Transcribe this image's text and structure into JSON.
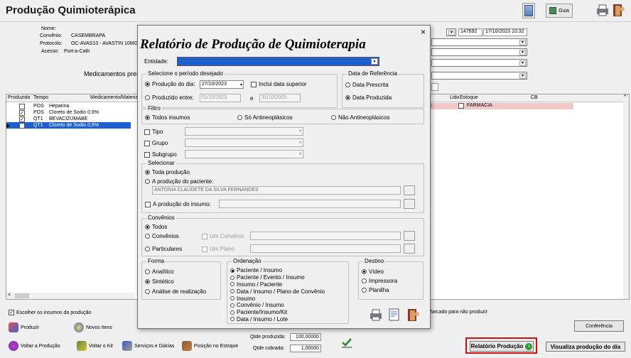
{
  "window": {
    "title": "Produção Quimioterápica"
  },
  "topbar": {
    "guia_label": "Guia"
  },
  "patient": {
    "name_label": "Nome:",
    "convenio_label": "Convênio:",
    "convenio_value": "CASEMBRAPA",
    "protocolo_label": "Protocolo:",
    "protocolo_value": "OC-AVAS10 - AVASTIN 10MG/",
    "acesso_label": "Acesso:",
    "acesso_value": "Port-a-Cath",
    "meds_label": "Medicamentos presc",
    "record_number": "147692",
    "record_datetime": "17/10/2023 10:32"
  },
  "grid": {
    "headers": {
      "produzido": "Produzido",
      "tempo": "Tempo",
      "medicamento": "Medicamento/Materia",
      "lido": "Lido",
      "estoque": "Estoque",
      "cb": "CB"
    },
    "rows": [
      {
        "checked": false,
        "tempo": "POS",
        "med": "Heparina"
      },
      {
        "checked": true,
        "tempo": "POS",
        "med": "Cloreto de Sodio 0,9%"
      },
      {
        "checked": true,
        "tempo": "QT1",
        "med": "BEVACIZUMABE"
      },
      {
        "checked": false,
        "tempo": "QT1",
        "med": "Cloreto de Sodio 0,9%",
        "selected": true
      }
    ],
    "pink_row": {
      "suffix": "rc",
      "estoque": "FARMACIA"
    }
  },
  "footer": {
    "escolher_label": "Escolher os insumos da produção",
    "marcado_label": "Marcado para não produzir",
    "conferencia_label": "Conferência",
    "produzir_label": "Produzir",
    "novos_itens_label": "Novos Itens",
    "voltar_producao_label": "Voltar a Produção",
    "voltar_kit_label": "Voltar o Kit",
    "servicos_label": "Serviços e Diárias",
    "posicao_label": "Posição no Estoque",
    "qtde_produzida_label": "Qtde produzida:",
    "qtde_produzida_value": "100,00000",
    "qtde_cobrada_label": "Qtde cobrada:",
    "qtde_cobrada_value": "1,00000",
    "relatorio_label": "Relatório Produção",
    "visualiza_label": "Visualiza produção do dia"
  },
  "dialog": {
    "close_glyph": "×",
    "title": "Relatório de Produção de Quimioterapia",
    "entidade_label": "Entidade:",
    "periodo": {
      "label": "Selecione o período desejado",
      "producao_dia_label": "Produção do dia:",
      "producao_dia_value": "27/10/2023",
      "incluir_label": "Inclui data superior",
      "produzido_entre_label": "Produzido entre:",
      "de_value": "01/10/2023",
      "e_label": "e",
      "ate_value": "31/10/2023"
    },
    "referencia": {
      "label": "Data de Referência",
      "prescrita_label": "Data Prescrita",
      "produzida_label": "Data Produzida"
    },
    "filtro": {
      "label": "Filtro",
      "todos_label": "Todos insumos",
      "so_label": "Só Antineoplásicos",
      "nao_label": "Não Antineoplásicos",
      "tipo_label": "Tipo",
      "grupo_label": "Grupo",
      "subgrupo_label": "Subgrupo"
    },
    "selecionar": {
      "label": "Selecionar",
      "toda_label": "Toda produção",
      "paciente_label": "A produção do paciente:",
      "paciente_value": "ANTONIA CLAUDETE DA SILVA FERNANDES",
      "insumo_label": "A produção do insumo:"
    },
    "convenios": {
      "label": "Convênios",
      "todos_label": "Todos",
      "convenios_label": "Convênios",
      "um_convenio_label": "Um Convênio",
      "particulares_label": "Particulares",
      "um_plano_label": "Um Plano"
    },
    "forma": {
      "label": "Forma",
      "analitico_label": "Analítico",
      "sintetico_label": "Sintético",
      "analise_label": "Análise de realização"
    },
    "ordenacao": {
      "label": "Ordenação",
      "items": [
        "Paciente / Insumo",
        "Paciente / Evento / Insumo",
        "Insumo / Paciente",
        "Data / Insumo / Plano de Convênio",
        "Insumo",
        "Convênio / Insumo",
        "Paciente/Insumo/Kit",
        "Data / Insumo / Lote"
      ]
    },
    "destino": {
      "label": "Destino",
      "video_label": "Vídeo",
      "impressora_label": "Impressora",
      "planilha_label": "Planilha"
    }
  }
}
